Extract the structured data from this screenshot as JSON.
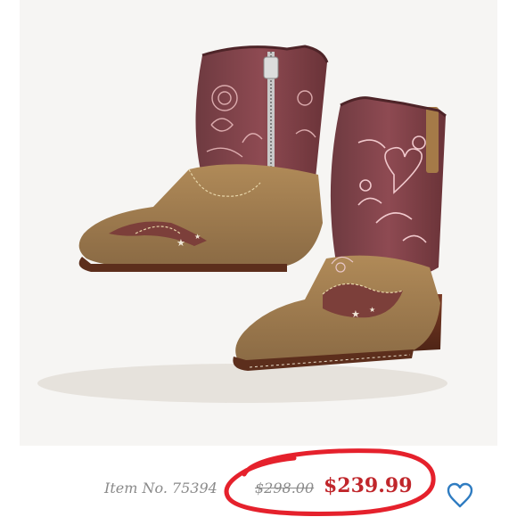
{
  "product": {
    "item_label": "Item No.",
    "item_number": "75394",
    "original_price": "$298.00",
    "sale_price": "$239.99",
    "image_name": "embroidered-cowboy-boots-image"
  },
  "colors": {
    "sale_price": "#c0262b",
    "circle_annotation": "#e5212c",
    "muted_text": "#8a8a8a",
    "heart_outline": "#2f7cc1"
  },
  "icons": {
    "favorite": "heart-outline-icon"
  }
}
